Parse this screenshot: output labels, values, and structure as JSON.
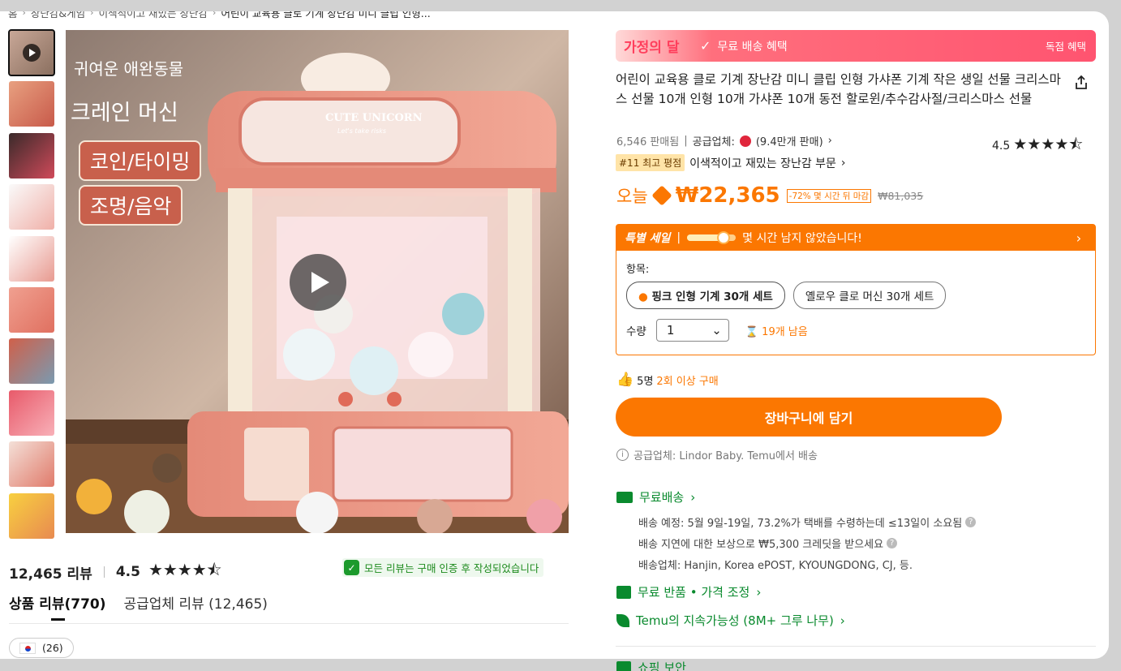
{
  "breadcrumb": [
    "홈",
    "장난감&게임",
    "이색적이고 재밌는 장난감",
    "어린이 교육용 클로 기계 장난감 미니 클립 인형..."
  ],
  "image": {
    "tags": [
      "귀여운 애완동물",
      "크레인 머신",
      "코인/타이밍",
      "조명/음악"
    ],
    "machine_sign": "CUTE UNICORN",
    "machine_sub": "Let's take risks"
  },
  "reviews": {
    "count": "12,465 리뷰",
    "score": "4.5",
    "stars": "★★★★⯪",
    "verified": "모든 리뷰는 구매 인증 후 작성되었습니다",
    "tabs": [
      "상품 리뷰(770)",
      "공급업체 리뷰 (12,465)"
    ],
    "country_count": "(26)"
  },
  "promo": {
    "brand": "가정의 달",
    "label": "무료 배송 혜택",
    "exclusive": "독점 혜택"
  },
  "product": {
    "title": "어린이 교육용 클로 기계 장난감 미니 클립 인형 가샤폰 기계 작은 생일 선물 크리스마스 선물 10개 인형 10개 가샤폰 10개 동전 할로윈/추수감사절/크리스마스 선물",
    "sold": "6,546 판매됨",
    "supplier_label": "공급업체:",
    "supplier_sales": "(9.4만개 판매)",
    "rating": "4.5",
    "stars": "★★★★⯪",
    "rank_badge": "#11 최고 평점",
    "rank_category": "이색적이고 재밌는 장난감 부문",
    "price_prefix": "오늘",
    "price": "₩22,365",
    "discount": "-72% 몇 시간 뒤 마감",
    "original_price": "₩81,035"
  },
  "sale": {
    "title": "특별 세일",
    "progress": 0.75,
    "message": "몇 시간 남지 않았습니다!",
    "options_label": "항목:",
    "options": [
      "핑크 인형 기계 30개 세트",
      "옐로우 클로 머신 30개 세트"
    ],
    "qty_label": "수량",
    "qty": "1",
    "stock": "19개 남음"
  },
  "social": {
    "count": "5명",
    "text": "2회 이상 구매"
  },
  "cart_button": "장바구니에 담기",
  "supplier_note": "공급업체: Lindor Baby. Temu에서 배송",
  "shipping": {
    "title": "무료배송",
    "line1": "배송 예정: 5월 9일-19일, 73.2%가 택배를 수령하는데 ≤13일이 소요됨",
    "line2": "배송 지연에 대한 보상으로 ₩5,300 크레딧을 받으세요",
    "line3": "배송업체: Hanjin, Korea ePOST, KYOUNGDONG, CJ, 등."
  },
  "returns": "무료 반품 • 가격 조정",
  "sustain": "Temu의 지속가능성 (8M+ 그루 나무)",
  "safety": "쇼핑 보안",
  "colors": {
    "accent": "#fb7701",
    "green": "#0a8a2e",
    "promo": "#ff5470"
  }
}
